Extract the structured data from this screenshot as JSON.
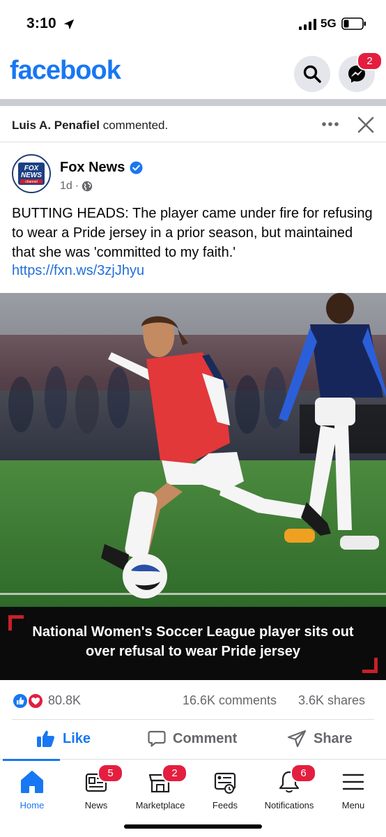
{
  "status_bar": {
    "time": "3:10",
    "network": "5G",
    "icons": [
      "location-arrow-icon",
      "signal-icon",
      "battery-icon"
    ]
  },
  "header": {
    "brand": "facebook",
    "messenger_badge": "2",
    "icons": [
      "search-icon",
      "messenger-icon"
    ]
  },
  "activity": {
    "name": "Luis A. Penafiel",
    "action": " commented.",
    "icons": [
      "more-options-icon",
      "close-icon"
    ]
  },
  "post": {
    "author": "Fox News",
    "time": "1d",
    "meta_separator": "·",
    "text": "BUTTING HEADS: The player came under fire for refusing to wear a Pride jersey in a prior season, but maintained that she was 'committed to my faith.'",
    "link": "https://fxn.ws/3zjJhyu",
    "logo_lines": [
      "FOX",
      "NEWS",
      "channel"
    ],
    "caption": "National Women's Soccer League player sits out over refusal to wear Pride jersey",
    "icons": [
      "verified-icon",
      "globe-icon"
    ]
  },
  "reactions": {
    "count": "80.8K",
    "comments": "16.6K comments",
    "shares": "3.6K shares",
    "icons": [
      "like-reaction-icon",
      "love-reaction-icon"
    ]
  },
  "actions": {
    "like": "Like",
    "comment": "Comment",
    "share": "Share"
  },
  "nav": {
    "items": [
      {
        "label": "Home",
        "icon": "home-icon",
        "active": true
      },
      {
        "label": "News",
        "icon": "news-icon",
        "badge": "5"
      },
      {
        "label": "Marketplace",
        "icon": "marketplace-icon",
        "badge": "2"
      },
      {
        "label": "Feeds",
        "icon": "feeds-icon"
      },
      {
        "label": "Notifications",
        "icon": "bell-icon",
        "badge": "6"
      },
      {
        "label": "Menu",
        "icon": "menu-icon"
      }
    ]
  },
  "colors": {
    "brand_blue": "#1877f2",
    "badge_red": "#e41e3f",
    "secondary_text": "#65676b",
    "link": "#216fdb"
  }
}
